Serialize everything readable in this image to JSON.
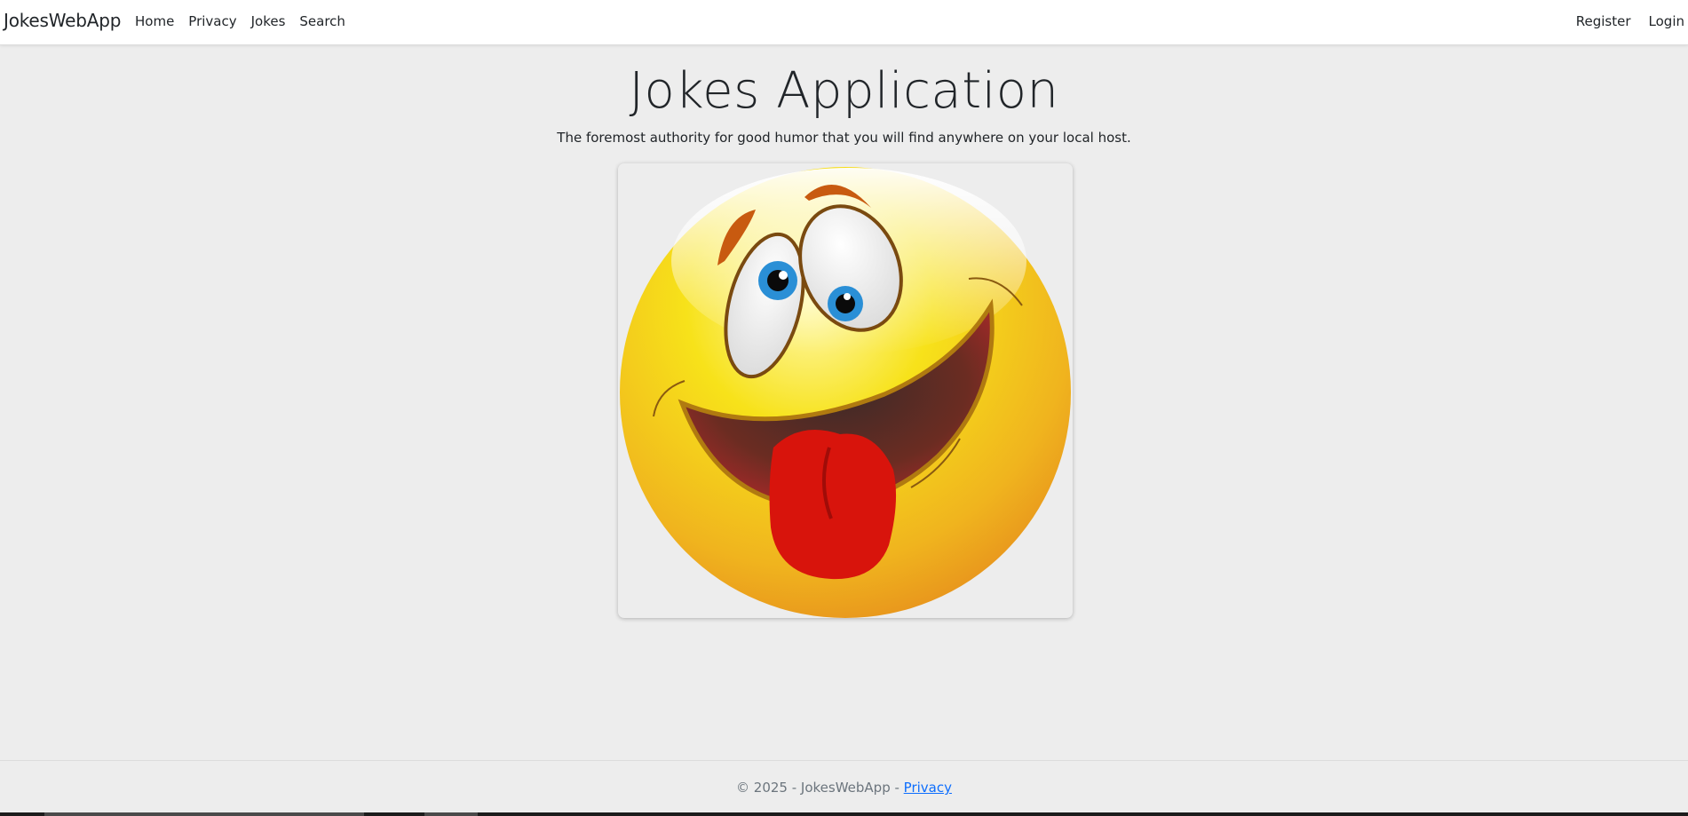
{
  "nav": {
    "brand": "JokesWebApp",
    "left_links": [
      "Home",
      "Privacy",
      "Jokes",
      "Search"
    ],
    "right_links": [
      "Register",
      "Login"
    ]
  },
  "hero": {
    "title": "Jokes Application",
    "subtitle": "The foremost authority for good humor that you will find anywhere on your local host."
  },
  "image": {
    "icon": "laughing-emoji-tongue-out",
    "colors": {
      "face_light": "#fff7a8",
      "face_mid": "#f7d81a",
      "face_dark": "#e8901c",
      "eye_blue": "#2a8fd6",
      "tongue": "#d8140c",
      "brow": "#c85a10"
    }
  },
  "footer": {
    "prefix": "© 2025 - JokesWebApp - ",
    "privacy_link": "Privacy"
  }
}
